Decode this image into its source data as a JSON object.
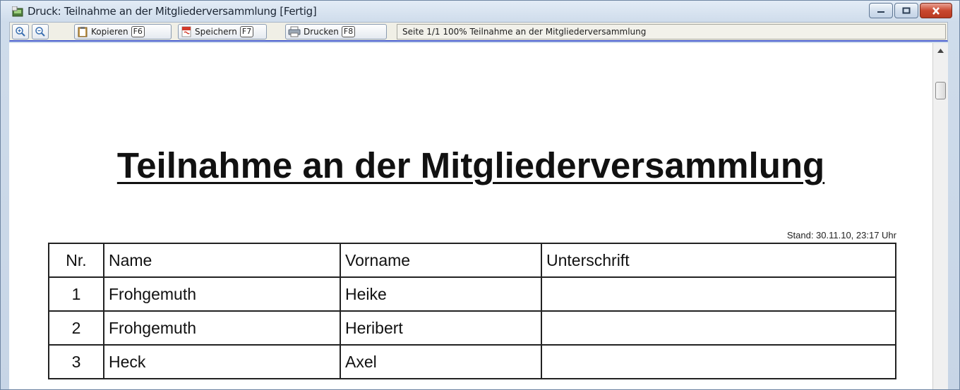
{
  "window": {
    "title": "Druck: Teilnahme an der Mitgliederversammlung [Fertig]"
  },
  "toolbar": {
    "zoom_in_icon": "zoom-in-icon",
    "zoom_out_icon": "zoom-out-icon",
    "copy_label": "Kopieren",
    "copy_key": "F6",
    "save_label": "Speichern",
    "save_key": "F7",
    "print_label": "Drucken",
    "print_key": "F8",
    "status": "Seite 1/1   100%   Teilnahme an der Mitgliederversammlung"
  },
  "document": {
    "heading": "Teilnahme an der Mitgliederversammlung",
    "stand": "Stand: 30.11.10, 23:17 Uhr",
    "columns": [
      "Nr.",
      "Name",
      "Vorname",
      "Unterschrift"
    ],
    "rows": [
      {
        "nr": "1",
        "name": "Frohgemuth",
        "vorname": "Heike",
        "unterschrift": ""
      },
      {
        "nr": "2",
        "name": "Frohgemuth",
        "vorname": "Heribert",
        "unterschrift": ""
      },
      {
        "nr": "3",
        "name": "Heck",
        "vorname": "Axel",
        "unterschrift": ""
      }
    ]
  },
  "colors": {
    "accent_underline": "#4a5fd0",
    "close_button": "#c9482f"
  }
}
